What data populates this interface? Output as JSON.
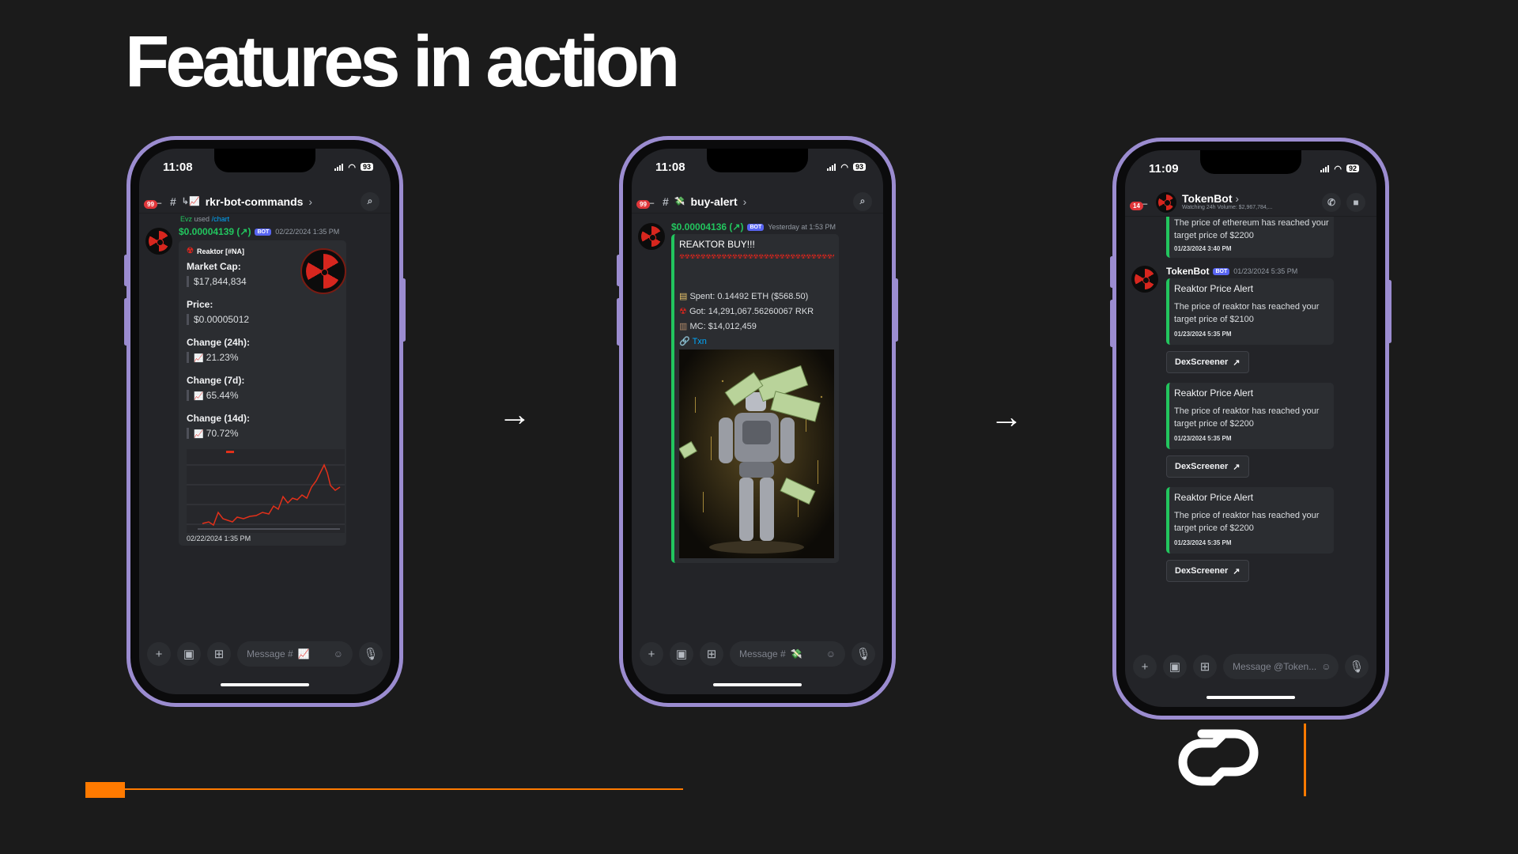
{
  "slide": {
    "title": "Features in action",
    "arrow_glyph": "→"
  },
  "phone1": {
    "time": "11:08",
    "battery": "93",
    "channel": "rkr-bot-commands",
    "badge": "99",
    "used_user": "Evz",
    "used_text": "used",
    "used_cmd": "/chart",
    "bot_name": "$0.00004139 (↗)",
    "bot_tag": "BOT",
    "timestamp": "02/22/2024 1:35 PM",
    "embed_author": "Reaktor [#NA]",
    "fields": [
      {
        "label": "Market Cap:",
        "value": "$17,844,834"
      },
      {
        "label": "Price:",
        "value": "$0.00005012"
      },
      {
        "label": "Change (24h):",
        "value": "21.23%"
      },
      {
        "label": "Change (7d):",
        "value": "65.44%"
      },
      {
        "label": "Change (14d):",
        "value": "70.72%"
      }
    ],
    "footer": "02/22/2024 1:35 PM",
    "input_placeholder": "Message #",
    "chart_color": "#e2301a"
  },
  "phone2": {
    "time": "11:08",
    "battery": "93",
    "channel": "buy-alert",
    "badge": "99",
    "bot_name": "$0.00004136 (↗)",
    "bot_tag": "BOT",
    "timestamp": "Yesterday at 1:53 PM",
    "buy_title": "REAKTOR BUY!!!",
    "lines": [
      {
        "icon": "money-icon",
        "text": "Spent: 0.14492 ETH ($568.50)"
      },
      {
        "icon": "radioactive-icon",
        "text": "Got: 14,291,067.56260067 RKR"
      },
      {
        "icon": "chest-icon",
        "text": "MC: $14,012,459"
      }
    ],
    "txn_link": "Txn",
    "input_placeholder": "Message #"
  },
  "phone3": {
    "time": "11:09",
    "battery": "92",
    "badge": "14",
    "bot_name": "TokenBot",
    "subtitle": "Watching 24h Volume: $2,967,784,...",
    "prev_alert": {
      "text": "The price of ethereum has reached your target price of $2200",
      "time": "01/23/2024 3:40 PM"
    },
    "author": "TokenBot",
    "bot_tag": "BOT",
    "author_time": "01/23/2024 5:35 PM",
    "alerts": [
      {
        "title": "Reaktor Price Alert",
        "text": "The price of reaktor has reached your target price of $2100",
        "time": "01/23/2024 5:35 PM",
        "button": "DexScreener"
      },
      {
        "title": "Reaktor Price Alert",
        "text": "The price of reaktor has reached your target price of $2200",
        "time": "01/23/2024 5:35 PM",
        "button": "DexScreener"
      },
      {
        "title": "Reaktor Price Alert",
        "text": "The price of reaktor has reached your target price of $2200",
        "time": "01/23/2024 5:35 PM",
        "button": "DexScreener"
      }
    ],
    "input_placeholder": "Message @Token..."
  },
  "colors": {
    "accent_orange": "#ff7a00",
    "discord_green": "#22c55e",
    "bot_blue": "#5865f2",
    "phone_frame": "#9b8cd0"
  }
}
